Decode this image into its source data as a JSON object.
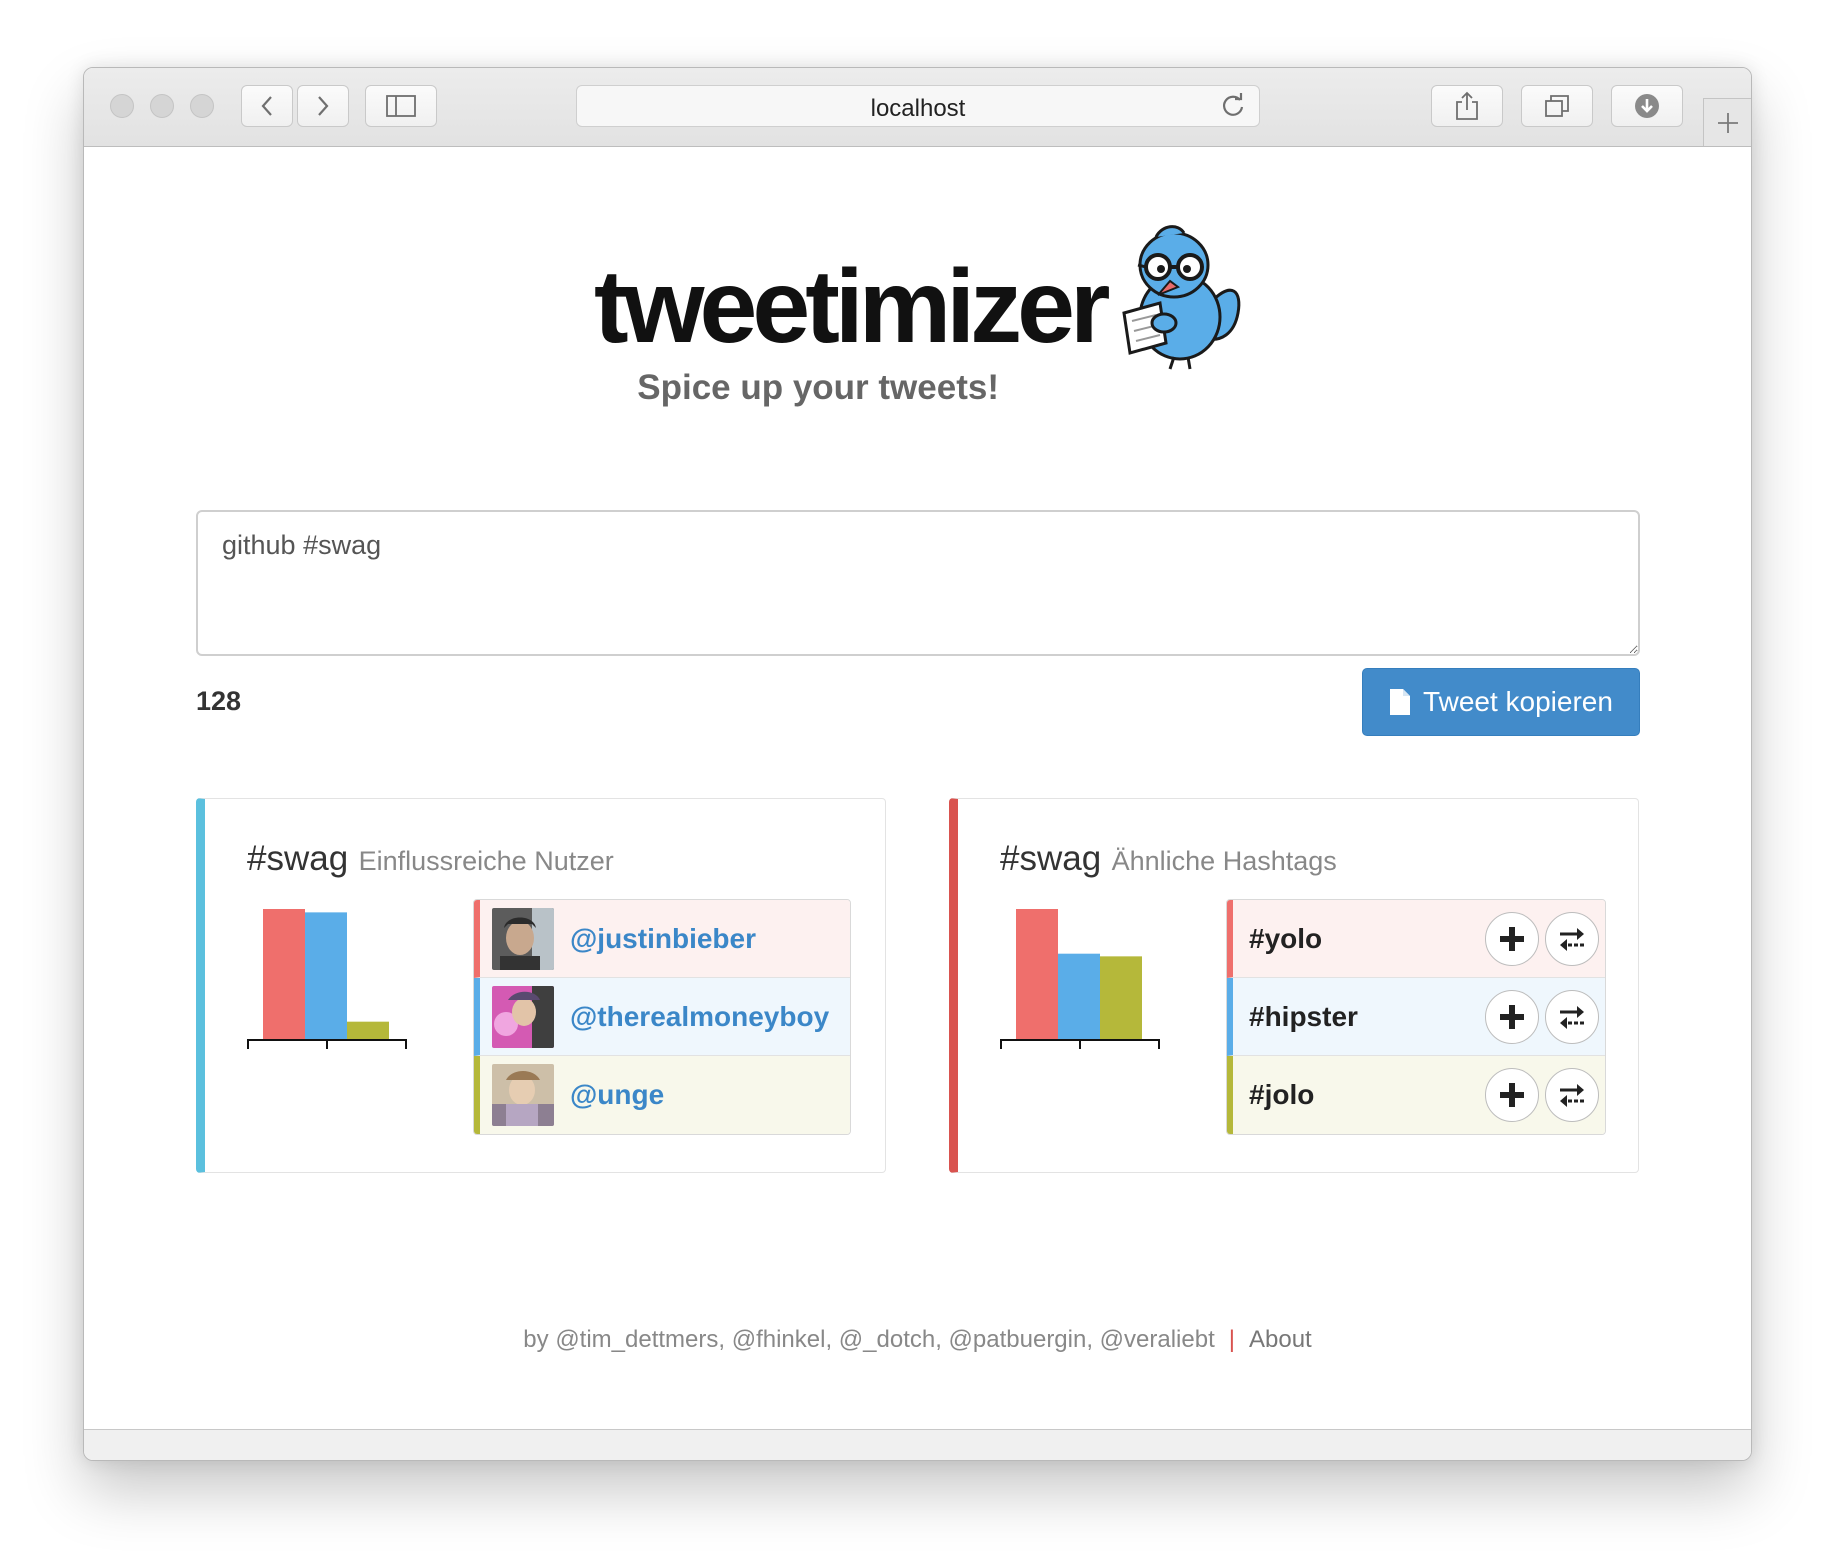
{
  "browser": {
    "url": "localhost"
  },
  "header": {
    "logo": "tweetimizer",
    "tagline": "Spice up your tweets!"
  },
  "editor": {
    "text": "github #swag",
    "char_count": "128",
    "copy_label": "Tweet kopieren"
  },
  "influencers": {
    "hashtag": "#swag",
    "subtitle": "Einflussreiche Nutzer",
    "users": [
      {
        "handle": "@justinbieber",
        "color": "#ef6f6c"
      },
      {
        "handle": "@therealmoneyboy",
        "color": "#5aade8"
      },
      {
        "handle": "@unge",
        "color": "#b5b83a"
      }
    ]
  },
  "similar": {
    "hashtag": "#swag",
    "subtitle": "Ähnliche Hashtags",
    "tags": [
      {
        "tag": "#yolo",
        "color": "#ef6f6c"
      },
      {
        "tag": "#hipster",
        "color": "#5aade8"
      },
      {
        "tag": "#jolo",
        "color": "#b5b83a"
      }
    ]
  },
  "chart_data": [
    {
      "type": "bar",
      "categories": [
        "@justinbieber",
        "@therealmoneyboy",
        "@unge"
      ],
      "values": [
        1.0,
        0.95,
        0.13
      ],
      "ylim": [
        0,
        1
      ]
    },
    {
      "type": "bar",
      "categories": [
        "#yolo",
        "#hipster",
        "#jolo"
      ],
      "values": [
        1.0,
        0.64,
        0.62
      ],
      "ylim": [
        0,
        1
      ]
    }
  ],
  "footer": {
    "credits": "by @tim_dettmers, @fhinkel, @_dotch, @patbuergin, @veraliebt",
    "separator": "|",
    "about": "About"
  },
  "colors": {
    "accent_blue": "#428bca",
    "panel_blue": "#5bc0de",
    "panel_red": "#d9534f"
  }
}
